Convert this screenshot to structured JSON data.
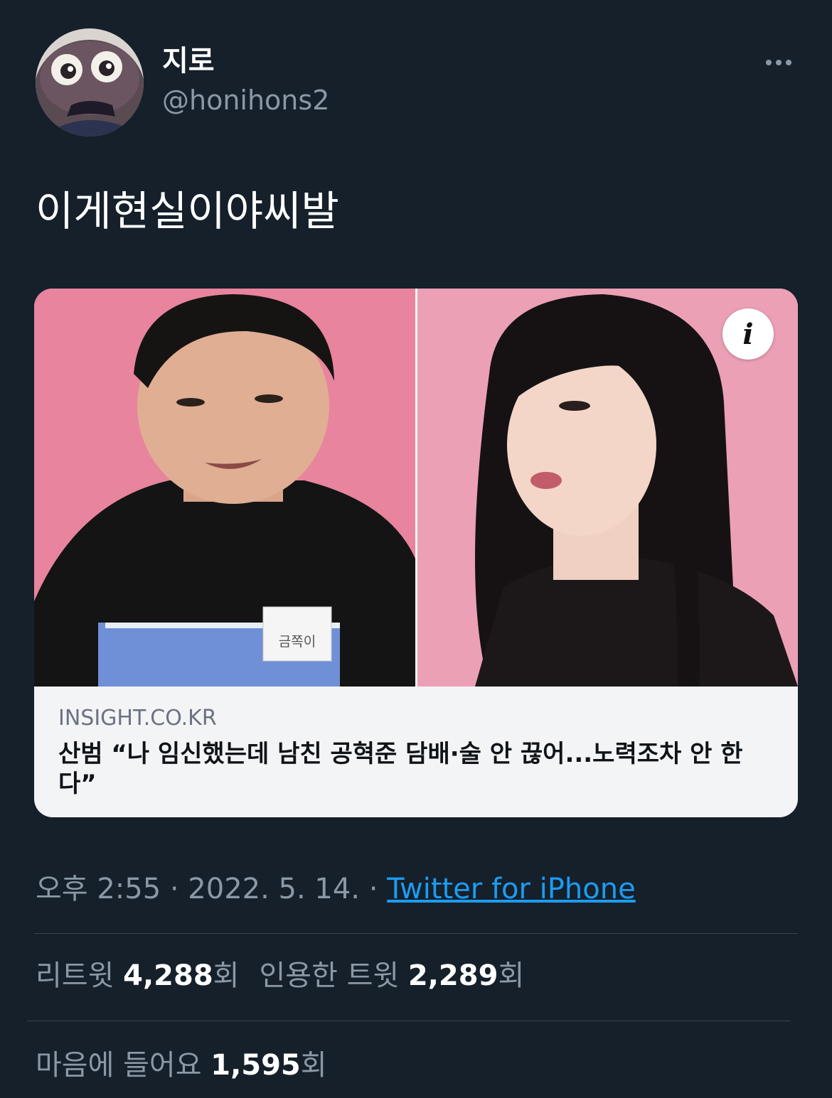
{
  "user": {
    "display_name": "지로",
    "handle": "@honihons2",
    "avatar_icon": "character-avatar"
  },
  "more_icon": "more-dots-icon",
  "tweet": {
    "text": "이게현실이야씨발"
  },
  "card": {
    "info_icon": "i",
    "domain": "INSIGHT.CO.KR",
    "title": "산범 “나 임신했는데 남친 공혁준 담배·술 안 끊어...노력조차 안 한다”",
    "image_caption_tag": "금쪽이",
    "background_color": "#e9879f"
  },
  "meta": {
    "time": "오후 2:55",
    "sep1": " · ",
    "date": "2022. 5. 14.",
    "sep2": " · ",
    "source": "Twitter for iPhone"
  },
  "stats": {
    "retweets_label": "리트윗 ",
    "retweets_count": "4,288",
    "retweets_unit": "회",
    "quotes_label": "인용한 트윗 ",
    "quotes_count": "2,289",
    "quotes_unit": "회",
    "likes_label": "마음에 들어요 ",
    "likes_count": "1,595",
    "likes_unit": "회"
  },
  "colors": {
    "background": "#15202b",
    "link": "#1d9bf0",
    "secondary_text": "#8b98a5",
    "divider": "#38444d"
  }
}
